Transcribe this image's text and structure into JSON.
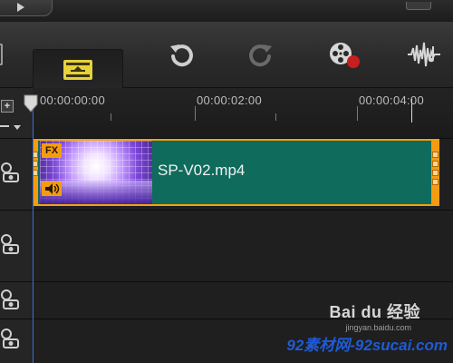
{
  "ruler": {
    "timecodes": [
      "00:00:00:00",
      "00:00:02:00",
      "00:00:04:00"
    ]
  },
  "toolbar": {
    "buttons": [
      {
        "name": "timeline-view",
        "icon": "timeline-view-icon",
        "active": true
      },
      {
        "name": "undo",
        "icon": "undo-icon"
      },
      {
        "name": "redo",
        "icon": "redo-icon",
        "disabled": true
      },
      {
        "name": "record-capture",
        "icon": "film-reel-record-icon"
      },
      {
        "name": "auto-music",
        "icon": "audio-wave-icon"
      }
    ]
  },
  "tracks": [
    {
      "type": "video",
      "icon": "camera-link-icon"
    },
    {
      "type": "overlay",
      "icon": "camera-link-icon"
    },
    {
      "type": "title",
      "icon": "camera-link-icon"
    },
    {
      "type": "voice",
      "icon": "camera-link-icon"
    }
  ],
  "clip": {
    "name": "SP-V02.mp4",
    "fx_badge": "FX",
    "has_audio": true,
    "border_color": "#f2a20c",
    "fill_color": "#0f6b5c"
  },
  "watermark": {
    "baidu": "Bai du 经验",
    "url": "jingyan.baidu.com",
    "site": "92素材网-92sucai.com"
  },
  "colors": {
    "accent": "#f39c12",
    "playhead": "#3a6fd8",
    "active_icon": "#e6d23a"
  }
}
